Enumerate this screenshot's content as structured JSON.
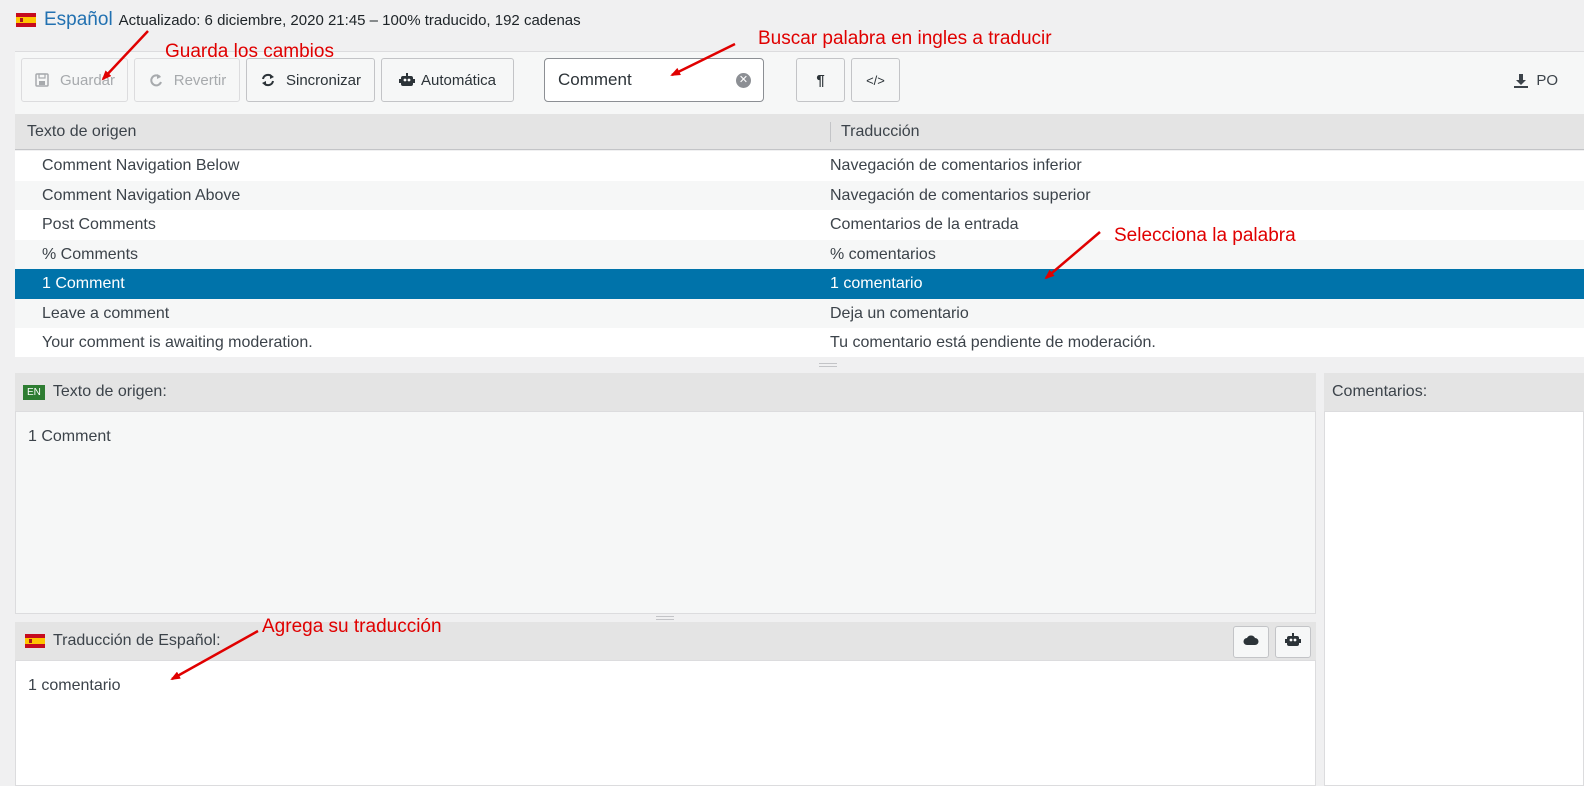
{
  "header": {
    "language": "Español",
    "meta": "Actualizado: 6 diciembre, 2020 21:45 – 100% traducido, 192 cadenas"
  },
  "toolbar": {
    "save_label": "Guardar",
    "revert_label": "Revertir",
    "sync_label": "Sincronizar",
    "auto_label": "Automática",
    "search_value": "Comment",
    "po_label": "PO"
  },
  "table": {
    "col_source": "Texto de origen",
    "col_translation": "Traducción",
    "rows": [
      {
        "source": "Comment Navigation Below",
        "translation": "Navegación de comentarios inferior"
      },
      {
        "source": "Comment Navigation Above",
        "translation": "Navegación de comentarios superior"
      },
      {
        "source": "Post Comments",
        "translation": "Comentarios de la entrada"
      },
      {
        "source": "% Comments",
        "translation": "% comentarios"
      },
      {
        "source": "1 Comment",
        "translation": "1 comentario"
      },
      {
        "source": "Leave a comment",
        "translation": "Deja un comentario"
      },
      {
        "source": "Your comment is awaiting moderation.",
        "translation": "Tu comentario está pendiente de moderación."
      }
    ]
  },
  "source_panel": {
    "badge": "EN",
    "title": "Texto de origen:",
    "text": "1 Comment"
  },
  "translation_panel": {
    "title": "Traducción de Español:",
    "text": "1 comentario"
  },
  "comments_panel": {
    "title": "Comentarios:"
  },
  "annotations": {
    "save": "Guarda los cambios",
    "search": "Buscar palabra en ingles a traducir",
    "select": "Selecciona la palabra",
    "translate": "Agrega su traducción"
  },
  "colors": {
    "accent": "#2271b1",
    "selected_row": "#0073aa",
    "annotation": "#e00000"
  }
}
